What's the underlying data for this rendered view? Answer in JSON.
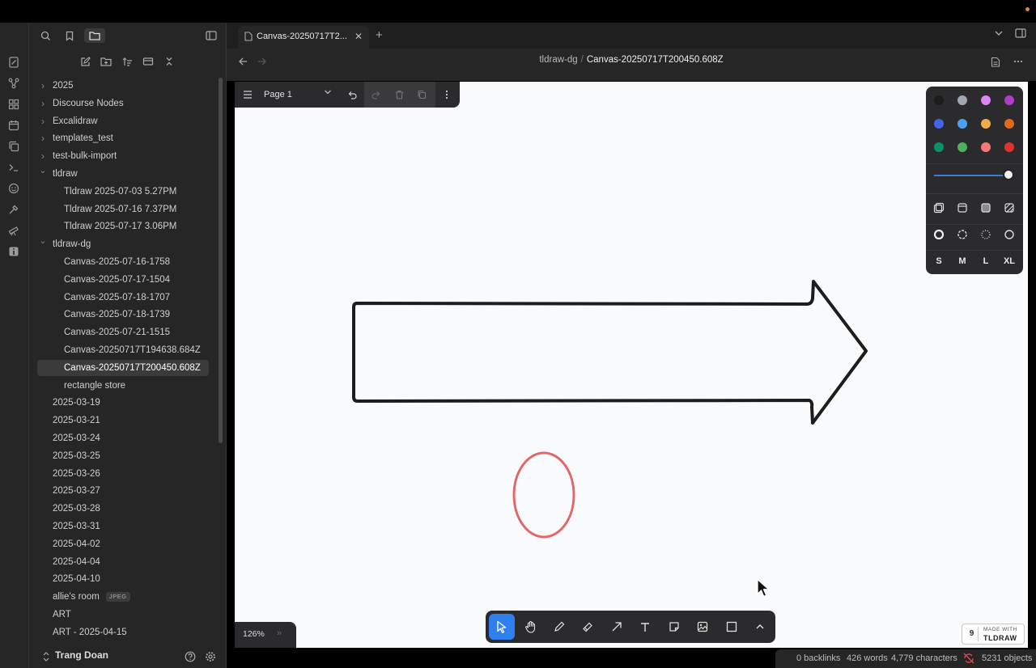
{
  "sidebar": {
    "tree": [
      {
        "label": "2025",
        "type": "folder",
        "expanded": false
      },
      {
        "label": "Discourse Nodes",
        "type": "folder",
        "expanded": false
      },
      {
        "label": "Excalidraw",
        "type": "folder",
        "expanded": false
      },
      {
        "label": "templates_test",
        "type": "folder",
        "expanded": false
      },
      {
        "label": "test-bulk-import",
        "type": "folder",
        "expanded": false
      },
      {
        "label": "tldraw",
        "type": "folder",
        "expanded": true
      },
      {
        "label": "Tldraw 2025-07-03 5.27PM",
        "type": "file",
        "depth": 1
      },
      {
        "label": "Tldraw 2025-07-16 7.37PM",
        "type": "file",
        "depth": 1
      },
      {
        "label": "Tldraw 2025-07-17 3.06PM",
        "type": "file",
        "depth": 1
      },
      {
        "label": "tldraw-dg",
        "type": "folder",
        "expanded": true
      },
      {
        "label": "Canvas-2025-07-16-1758",
        "type": "file",
        "depth": 1
      },
      {
        "label": "Canvas-2025-07-17-1504",
        "type": "file",
        "depth": 1
      },
      {
        "label": "Canvas-2025-07-18-1707",
        "type": "file",
        "depth": 1
      },
      {
        "label": "Canvas-2025-07-18-1739",
        "type": "file",
        "depth": 1
      },
      {
        "label": "Canvas-2025-07-21-1515",
        "type": "file",
        "depth": 1
      },
      {
        "label": "Canvas-20250717T194638.684Z",
        "type": "file",
        "depth": 1
      },
      {
        "label": "Canvas-20250717T200450.608Z",
        "type": "file",
        "depth": 1,
        "selected": true
      },
      {
        "label": "rectangle store",
        "type": "file",
        "depth": 1
      },
      {
        "label": "2025-03-19",
        "type": "file",
        "depth": 0
      },
      {
        "label": "2025-03-21",
        "type": "file",
        "depth": 0
      },
      {
        "label": "2025-03-24",
        "type": "file",
        "depth": 0
      },
      {
        "label": "2025-03-25",
        "type": "file",
        "depth": 0
      },
      {
        "label": "2025-03-26",
        "type": "file",
        "depth": 0
      },
      {
        "label": "2025-03-27",
        "type": "file",
        "depth": 0
      },
      {
        "label": "2025-03-28",
        "type": "file",
        "depth": 0
      },
      {
        "label": "2025-03-31",
        "type": "file",
        "depth": 0
      },
      {
        "label": "2025-04-02",
        "type": "file",
        "depth": 0
      },
      {
        "label": "2025-04-04",
        "type": "file",
        "depth": 0
      },
      {
        "label": "2025-04-10",
        "type": "file",
        "depth": 0
      },
      {
        "label": "allie's room",
        "type": "file",
        "depth": 0,
        "badge": "JPEG"
      },
      {
        "label": "ART",
        "type": "file",
        "depth": 0
      },
      {
        "label": "ART - 2025-04-15",
        "type": "file",
        "depth": 0
      }
    ],
    "vault_name": "Trang Doan"
  },
  "tab": {
    "label": "Canvas-20250717T2..."
  },
  "breadcrumb": {
    "parent": "tldraw-dg",
    "separator": "/",
    "current": "Canvas-20250717T200450.608Z"
  },
  "canvas": {
    "page_name": "Page 1",
    "zoom": "126%",
    "zoom_expand": "»",
    "watermark_line1": "MADE WITH",
    "watermark_line2": "TLDRAW",
    "watermark_logo": "9",
    "arrow_stroke": "#1d1d1d",
    "ellipse_stroke": "#e06868"
  },
  "style_panel": {
    "colors": [
      "#1d1d1d",
      "#9fa8b2",
      "#e085f4",
      "#ae3ec9",
      "#4465e9",
      "#4ba1f1",
      "#f1ac4b",
      "#e16919",
      "#099268",
      "#4cb05e",
      "#f87777",
      "#e03131"
    ],
    "sizes": [
      "S",
      "M",
      "L",
      "XL"
    ]
  },
  "status": {
    "backlinks": "0 backlinks",
    "words": "426 words",
    "characters": "4,779 characters",
    "objects": "5231 objects"
  }
}
